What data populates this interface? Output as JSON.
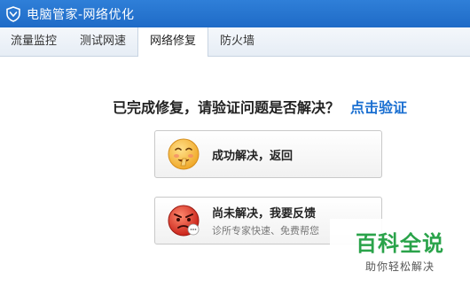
{
  "window": {
    "title": "电脑管家-网络优化"
  },
  "tabs": [
    {
      "label": "流量监控"
    },
    {
      "label": "测试网速"
    },
    {
      "label": "网络修复"
    },
    {
      "label": "防火墙"
    }
  ],
  "active_tab": "网络修复",
  "content": {
    "question": "已完成修复，请验证问题是否解决？",
    "verify_link": "点击验证",
    "resolved_button": {
      "label": "成功解决，返回"
    },
    "unresolved_button": {
      "label": "尚未解决，我要反馈",
      "subtext": "诊所专家快速、免费帮您"
    }
  },
  "watermark": {
    "brand": "百科全说",
    "tagline": "助你轻松解决"
  },
  "colors": {
    "titlebar": "#2a78d4",
    "link": "#1a6fd1",
    "watermark_green": "#2aa34a",
    "happy_face": "#f6c34a",
    "angry_face": "#e03a2e"
  }
}
